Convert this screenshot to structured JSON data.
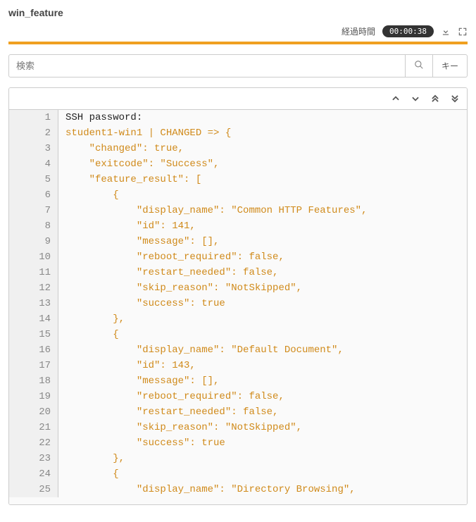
{
  "title": "win_feature",
  "header": {
    "elapsed_label": "経過時間",
    "elapsed_value": "00:00:38"
  },
  "search": {
    "placeholder": "検索",
    "key_label": "キー"
  },
  "code": {
    "lines": [
      {
        "n": 1,
        "text": "SSH password:",
        "black": true
      },
      {
        "n": 2,
        "text": "student1-win1 | CHANGED => {"
      },
      {
        "n": 3,
        "text": "    \"changed\": true,"
      },
      {
        "n": 4,
        "text": "    \"exitcode\": \"Success\","
      },
      {
        "n": 5,
        "text": "    \"feature_result\": ["
      },
      {
        "n": 6,
        "text": "        {"
      },
      {
        "n": 7,
        "text": "            \"display_name\": \"Common HTTP Features\","
      },
      {
        "n": 8,
        "text": "            \"id\": 141,"
      },
      {
        "n": 9,
        "text": "            \"message\": [],"
      },
      {
        "n": 10,
        "text": "            \"reboot_required\": false,"
      },
      {
        "n": 11,
        "text": "            \"restart_needed\": false,"
      },
      {
        "n": 12,
        "text": "            \"skip_reason\": \"NotSkipped\","
      },
      {
        "n": 13,
        "text": "            \"success\": true"
      },
      {
        "n": 14,
        "text": "        },"
      },
      {
        "n": 15,
        "text": "        {"
      },
      {
        "n": 16,
        "text": "            \"display_name\": \"Default Document\","
      },
      {
        "n": 17,
        "text": "            \"id\": 143,"
      },
      {
        "n": 18,
        "text": "            \"message\": [],"
      },
      {
        "n": 19,
        "text": "            \"reboot_required\": false,"
      },
      {
        "n": 20,
        "text": "            \"restart_needed\": false,"
      },
      {
        "n": 21,
        "text": "            \"skip_reason\": \"NotSkipped\","
      },
      {
        "n": 22,
        "text": "            \"success\": true"
      },
      {
        "n": 23,
        "text": "        },"
      },
      {
        "n": 24,
        "text": "        {"
      },
      {
        "n": 25,
        "text": "            \"display_name\": \"Directory Browsing\","
      }
    ]
  }
}
